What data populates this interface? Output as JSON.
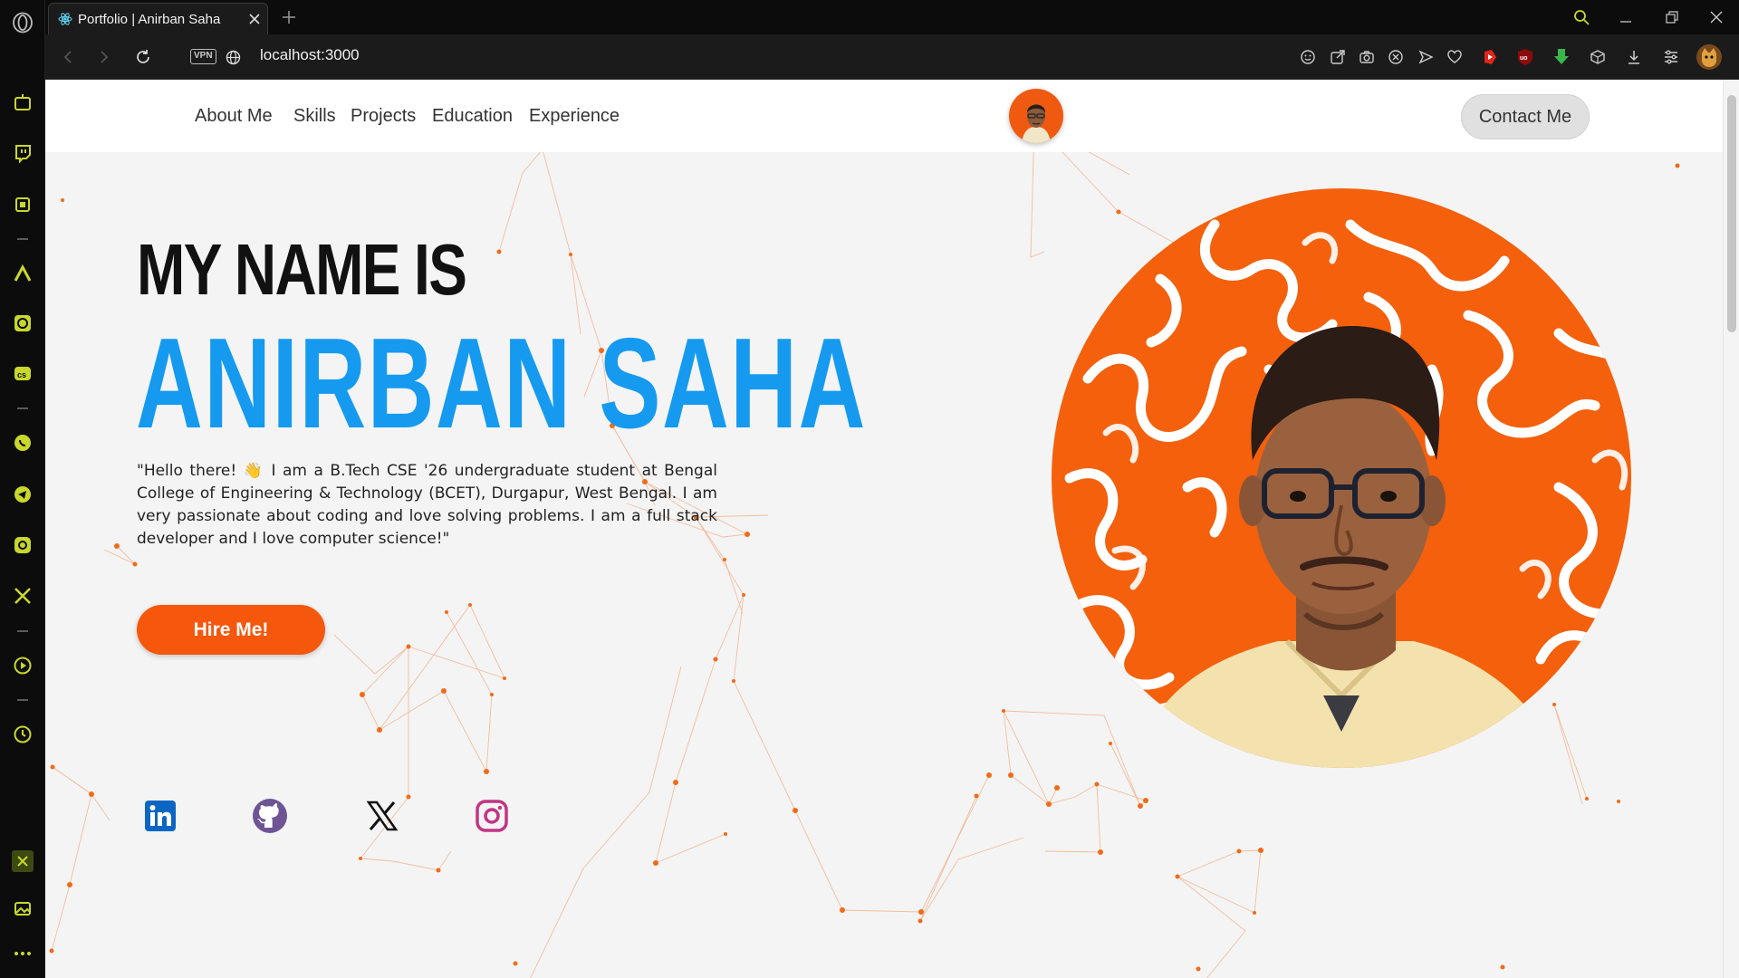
{
  "browser": {
    "tab_title": "Portfolio | Anirban Saha",
    "url": "localhost:3000",
    "vpn_label": "VPN"
  },
  "colors": {
    "accent_orange": "#f5570c",
    "name_blue": "#159af0",
    "opera_sidebar_icon": "#c9d72b"
  },
  "sidebar_icons": [
    "opera-logo-icon",
    "aria-icon",
    "twitch-icon",
    "chip-icon",
    "autodesk-icon",
    "chatgpt-icon",
    "cs-icon",
    "whatsapp-icon",
    "telegram-icon",
    "instagram-icon",
    "x-icon",
    "player-icon",
    "history-icon",
    "extension-icon",
    "gallery-icon",
    "more-icon"
  ],
  "nav": {
    "links": [
      "About Me",
      "Skills",
      "Projects",
      "Education",
      "Experience"
    ],
    "contact_label": "Contact Me"
  },
  "hero": {
    "intro": "MY NAME IS",
    "name": "ANIRBAN SAHA",
    "bio": "\"Hello there! 👋 I am a B.Tech CSE '26 undergraduate student at Bengal College of Engineering & Technology (BCET), Durgapur, West Bengal. I am very passionate about coding and love solving problems. I am a full stack developer and I love computer science!\"",
    "hire_label": "Hire Me!"
  },
  "socials": [
    "linkedin-icon",
    "github-icon",
    "x-icon",
    "instagram-icon"
  ]
}
